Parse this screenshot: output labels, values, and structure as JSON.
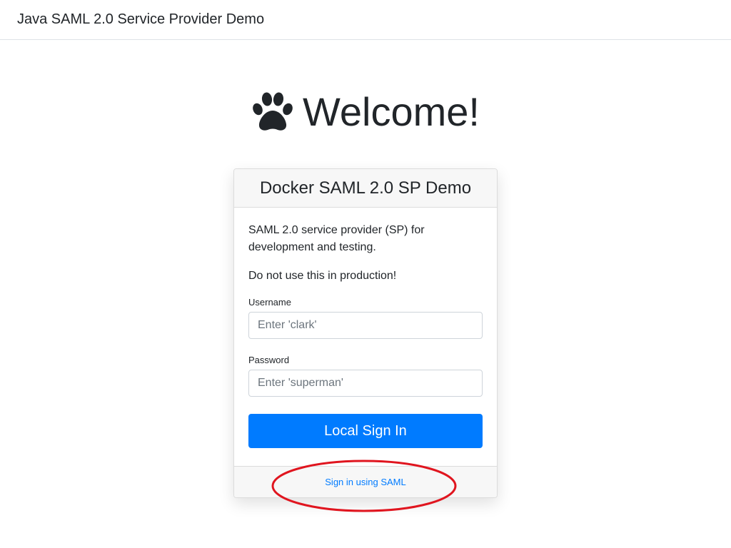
{
  "navbar": {
    "brand": "Java SAML 2.0 Service Provider Demo"
  },
  "hero": {
    "icon": "paw-icon",
    "title": "Welcome!"
  },
  "card": {
    "header": "Docker SAML 2.0 SP Demo",
    "description": "SAML 2.0 service provider (SP) for development and testing.",
    "warning": "Do not use this in production!",
    "username": {
      "label": "Username",
      "placeholder": "Enter 'clark'",
      "value": ""
    },
    "password": {
      "label": "Password",
      "placeholder": "Enter 'superman'",
      "value": ""
    },
    "submit_label": "Local Sign In",
    "footer_link": "Sign in using SAML"
  },
  "colors": {
    "primary": "#007bff",
    "annotation": "#e0151f"
  }
}
